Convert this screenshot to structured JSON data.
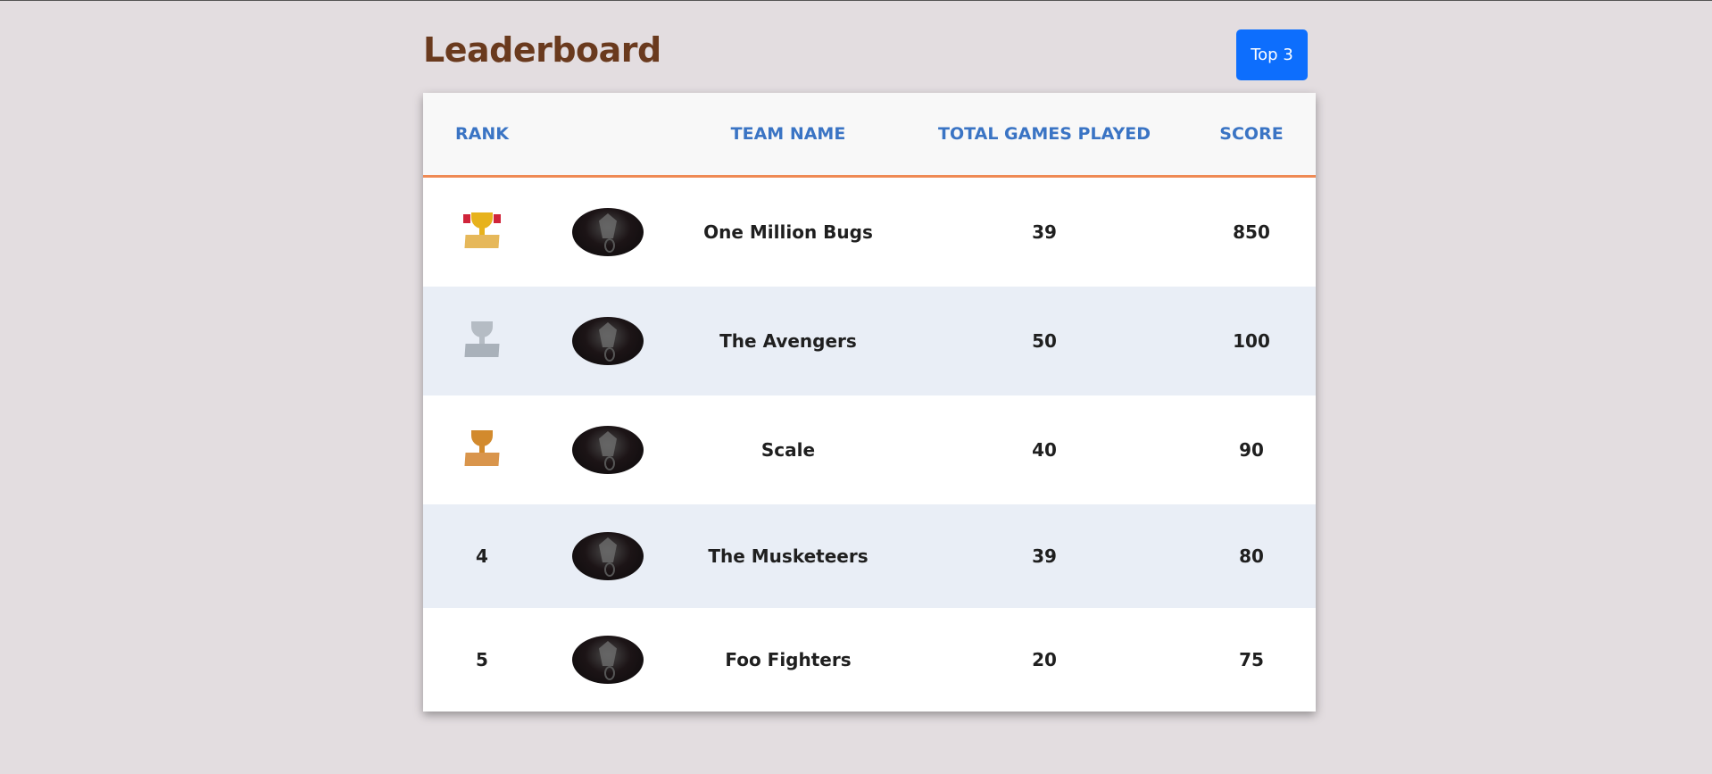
{
  "header": {
    "title": "Leaderboard",
    "top3_label": "Top 3"
  },
  "table": {
    "columns": {
      "rank": "RANK",
      "logo": "",
      "team": "TEAM NAME",
      "games": "TOTAL GAMES PLAYED",
      "score": "SCORE"
    },
    "rows": [
      {
        "rank_icon": "gold-trophy-icon",
        "logo_icon": "dragon-logo-icon",
        "team": "One Million Bugs",
        "games": "39",
        "score": "850"
      },
      {
        "rank_icon": "silver-trophy-icon",
        "logo_icon": "dragon-logo-icon",
        "team": "The Avengers",
        "games": "50",
        "score": "100"
      },
      {
        "rank_icon": "bronze-trophy-icon",
        "logo_icon": "dragon-logo-icon",
        "team": "Scale",
        "games": "40",
        "score": "90"
      },
      {
        "rank": "4",
        "logo_icon": "dragon-logo-icon",
        "team": "The Musketeers",
        "games": "39",
        "score": "80"
      },
      {
        "rank": "5",
        "logo_icon": "dragon-logo-icon",
        "team": "Foo Fighters",
        "games": "20",
        "score": "75"
      }
    ]
  },
  "colors": {
    "background": "#e3dde0",
    "title": "#6a3a1e",
    "button": "#0d6efd",
    "header_text": "#3a74c4",
    "header_underline": "#ef8a54",
    "stripe": "#e9eef6"
  }
}
